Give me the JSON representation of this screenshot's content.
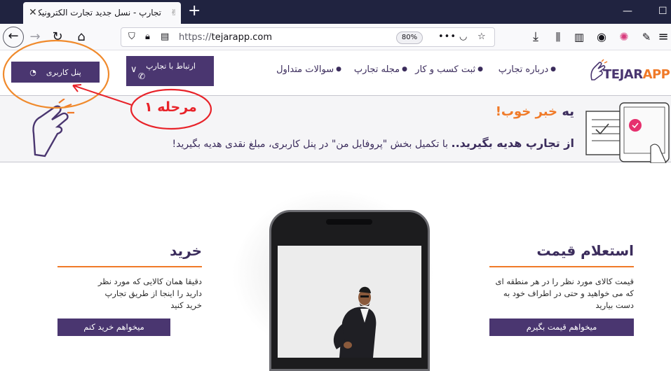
{
  "browser": {
    "tab_title": "تجارپ - نسل جدید تجارت الکترونیک",
    "url_protocol": "https://",
    "url_domain": "tejarapp.com",
    "zoom": "80%"
  },
  "header": {
    "panel_button": "پنل کاربری",
    "contact_button": "ارتباط با تجارپ",
    "menu": [
      "درباره تجارپ",
      "ثبت کسب و کار",
      "مجله تجارپ",
      "سوالات متداول"
    ],
    "logo_main": "TEJAR",
    "logo_accent": "APP"
  },
  "banner": {
    "line1_prefix": "یه",
    "line1_highlight": "خبر خوب!",
    "line2_bold": "از تجارپ هدیه بگیرید..",
    "line2_rest": "با تکمیل بخش \"پروفایل من\" در پنل کاربری، مبلغ نقدی هدیه بگیرید!"
  },
  "annotation": {
    "step_label": "مرحله ۱"
  },
  "features": {
    "price": {
      "title": "استعلام قیمت",
      "text": "قیمت کالای مورد نظر را در هر منطقه ای که می خواهید و حتی در اطراف خود به دست بیارید",
      "cta": "میخواهم قیمت بگیرم"
    },
    "buy": {
      "title": "خرید",
      "text": "دقیقا همان کالایی که مورد نظر دارید را اینجا از طریق تجارپ خرید کنید",
      "cta": "میخواهم خرید کنم"
    }
  },
  "colors": {
    "brand_purple": "#4a3670",
    "brand_orange": "#f07a28",
    "annotation_red": "#e8232a",
    "annotation_orange": "#f08a2c"
  }
}
